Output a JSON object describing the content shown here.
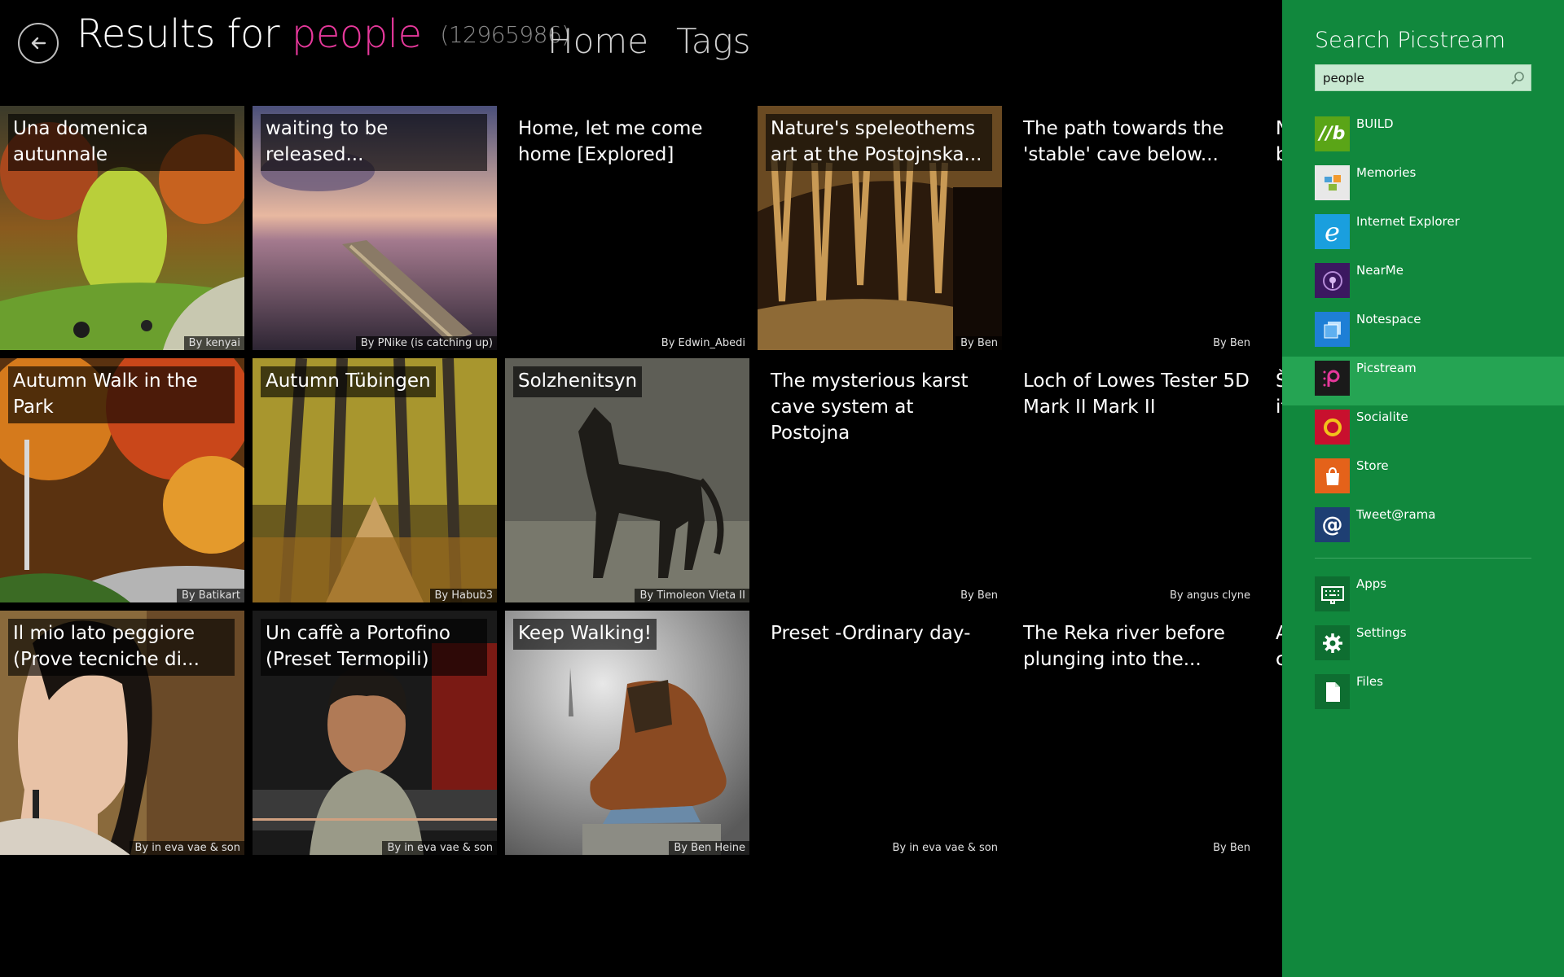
{
  "header": {
    "title_prefix": "Results for",
    "query": "people",
    "count": "(12965986)",
    "nav": [
      "Home",
      "Tags"
    ]
  },
  "tiles": [
    {
      "title": "Una domenica autunnale",
      "author": "By kenyai",
      "has_image": true,
      "image_subject": "autumn-park"
    },
    {
      "title": "waiting to be released...",
      "author": "By PNike (is catching up)",
      "has_image": true,
      "image_subject": "beach-sunset-boat",
      "selected": true
    },
    {
      "title": "Home, let me come home [Explored]",
      "author": "By Edwin_Abedi",
      "has_image": false
    },
    {
      "title": "Nature's speleothems art at the Postojnska...",
      "author": "By Ben",
      "has_image": true,
      "image_subject": "cave"
    },
    {
      "title": "The path towards the 'stable' cave below...",
      "author": "By Ben",
      "has_image": false
    },
    {
      "title": "Autumn Walk in the Park",
      "author": "By Batikart",
      "has_image": true,
      "image_subject": "autumn-path"
    },
    {
      "title": "Autumn Tübingen",
      "author": "By Habub3",
      "has_image": true,
      "image_subject": "tree-alley",
      "selected": true
    },
    {
      "title": "Solzhenitsyn",
      "author": "By Timoleon Vieta II",
      "has_image": true,
      "image_subject": "horse"
    },
    {
      "title": "The  mysterious karst cave system at Postojna",
      "author": "By Ben",
      "has_image": false
    },
    {
      "title": "Loch of Lowes Tester 5D Mark II Mark II",
      "author": "By angus clyne",
      "has_image": false
    },
    {
      "title": "Il mio lato peggiore (Prove tecniche di...",
      "author": "By in eva vae & son",
      "has_image": true,
      "image_subject": "woman-portrait",
      "selected": true
    },
    {
      "title": "Un caffè a Portofino (Preset Termopili)",
      "author": "By in eva vae & son",
      "has_image": true,
      "image_subject": "man-cafe"
    },
    {
      "title": "Keep Walking!",
      "author": "By Ben Heine",
      "has_image": true,
      "image_subject": "boot"
    },
    {
      "title": "Preset -Ordinary day-",
      "author": "By in eva vae & son",
      "has_image": false
    },
    {
      "title": "The Reka river before plunging into the...",
      "author": "By Ben",
      "has_image": false
    }
  ],
  "clipped_column": [
    "N\nb",
    "Š\nit",
    "A\nc"
  ],
  "search_pane": {
    "heading": "Search Picstream",
    "query_value": "people",
    "apps": [
      {
        "label": "BUILD",
        "icon": "build-icon",
        "color": "#5aa517"
      },
      {
        "label": "Memories",
        "icon": "memories-icon",
        "color": "#e8e8e8"
      },
      {
        "label": "Internet Explorer",
        "icon": "internet-explorer-icon",
        "color": "#1a9fde"
      },
      {
        "label": "NearMe",
        "icon": "nearme-icon",
        "color": "#3b1860"
      },
      {
        "label": "Notespace",
        "icon": "notespace-icon",
        "color": "#1e7fd6"
      },
      {
        "label": "Picstream",
        "icon": "picstream-icon",
        "color": "#1a1a1a",
        "active": true
      },
      {
        "label": "Socialite",
        "icon": "socialite-icon",
        "color": "#c8102e"
      },
      {
        "label": "Store",
        "icon": "store-icon",
        "color": "#e4621a"
      },
      {
        "label": "Tweet@rama",
        "icon": "tweetrama-icon",
        "color": "#1e3f73"
      }
    ],
    "bottom": [
      {
        "label": "Apps",
        "icon": "keyboard-icon"
      },
      {
        "label": "Settings",
        "icon": "gear-icon"
      },
      {
        "label": "Files",
        "icon": "file-icon"
      }
    ]
  },
  "colors": {
    "accent_query": "#e6389b",
    "pane_bg": "#11883d",
    "pane_active": "#25a453"
  }
}
